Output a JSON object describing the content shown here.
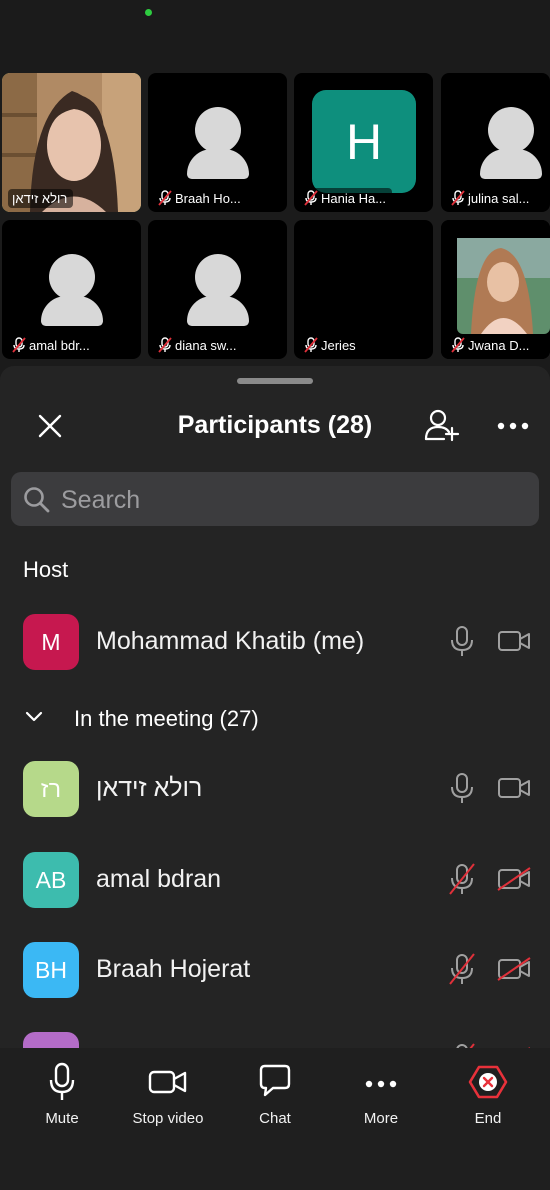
{
  "video_grid": {
    "tiles": [
      {
        "name": "רולא זידאן",
        "muted": false,
        "kind": "photo"
      },
      {
        "name": "Braah Ho...",
        "muted": true,
        "kind": "avatar"
      },
      {
        "name": "Hania Ha...",
        "muted": true,
        "kind": "letter",
        "letter": "H"
      },
      {
        "name": "julina sal...",
        "muted": true,
        "kind": "avatar"
      },
      {
        "name": "amal bdr...",
        "muted": true,
        "kind": "avatar"
      },
      {
        "name": "diana sw...",
        "muted": true,
        "kind": "avatar"
      },
      {
        "name": "Jeries",
        "muted": true,
        "kind": "blank"
      },
      {
        "name": "Jwana D...",
        "muted": true,
        "kind": "photo"
      }
    ]
  },
  "panel": {
    "title": "Participants (28)",
    "search_placeholder": "Search",
    "host_section": "Host",
    "meeting_section": "In the meeting (27)"
  },
  "participants": [
    {
      "initials": "M",
      "name": "Mohammad Khatib (me)",
      "color": "#c6184f",
      "mic_on": true,
      "cam_on": true
    },
    {
      "initials": "רז",
      "name": "רולא זידאן",
      "color": "#b6d98a",
      "mic_on": true,
      "cam_on": true
    },
    {
      "initials": "AB",
      "name": "amal bdran",
      "color": "#3dbcae",
      "mic_on": false,
      "cam_on": false
    },
    {
      "initials": "BH",
      "name": "Braah Hojerat",
      "color": "#3bb8f4",
      "mic_on": false,
      "cam_on": false
    },
    {
      "initials": "",
      "name": "",
      "color": "#b46cc8",
      "mic_on": false,
      "cam_on": false
    }
  ],
  "toolbar": {
    "mute": "Mute",
    "stop_video": "Stop video",
    "chat": "Chat",
    "more": "More",
    "end": "End"
  },
  "colors": {
    "active_speaker": "#3bd46b",
    "muted_red": "#e0303a",
    "end_red": "#e8313a"
  }
}
